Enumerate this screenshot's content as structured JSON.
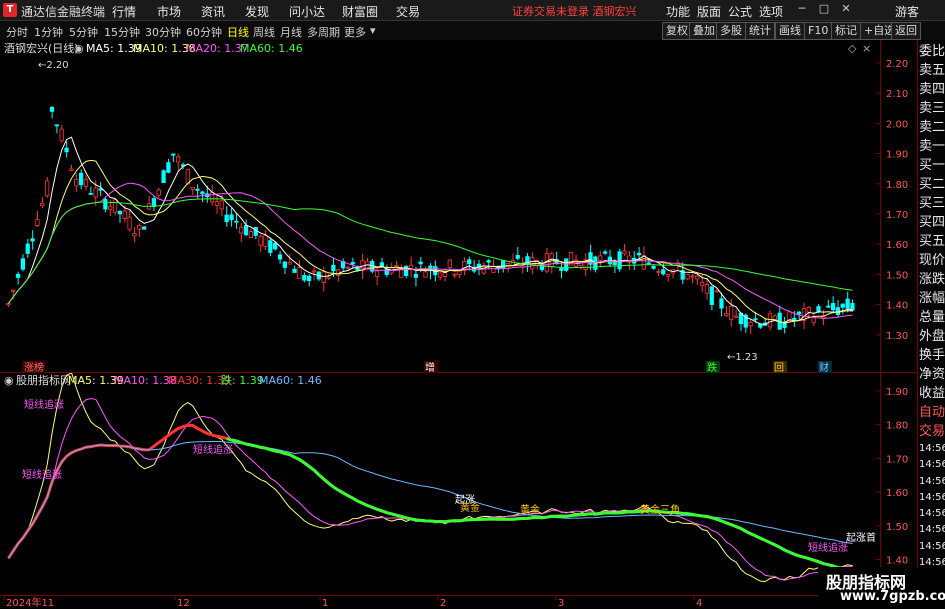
{
  "app": {
    "title": "通达信金融终端",
    "logo": "T"
  },
  "menu": [
    "行情",
    "市场",
    "资讯",
    "发现",
    "问小达",
    "财富圈",
    "交易"
  ],
  "notice": "证券交易未登录  酒钢宏兴",
  "right_menu": [
    "功能",
    "版面",
    "公式",
    "选项"
  ],
  "user": "游客",
  "toolbar": {
    "periods": [
      "分时",
      "1分钟",
      "5分钟",
      "15分钟",
      "30分钟",
      "60分钟",
      "日线",
      "周线",
      "月线",
      "多周期",
      "更多"
    ],
    "active_period": "日线",
    "right_buttons": [
      "复权",
      "叠加",
      "多股",
      "统计",
      "画线",
      "F10",
      "标记",
      "+自选",
      "返回"
    ]
  },
  "main_chart": {
    "title": "酒钢宏兴(日线)",
    "ma_legend": [
      {
        "label": "MA5: 1.39",
        "color": "#ffffff"
      },
      {
        "label": "MA10: 1.38",
        "color": "#ffff66"
      },
      {
        "label": "MA20: 1.37",
        "color": "#ff55ff"
      },
      {
        "label": "MA60: 1.46",
        "color": "#33ff33"
      }
    ],
    "y_ticks": [
      "2.20",
      "2.10",
      "2.00",
      "1.90",
      "1.80",
      "1.70",
      "1.60",
      "1.50",
      "1.40",
      "1.30"
    ],
    "high_label": "2.20",
    "low_label": "1.23",
    "markers": [
      "涨榜",
      "增",
      "跌",
      "回",
      "财"
    ]
  },
  "sub_chart": {
    "title": "股朋指标网",
    "legend": [
      {
        "label": "MA5: 1.39",
        "color": "#ffff66"
      },
      {
        "label": "MA10: 1.38",
        "color": "#ff55ff"
      },
      {
        "label": "MA30: 1.39",
        "color": "#ff3333"
      },
      {
        "label": "跌: 1.39",
        "color": "#33ff33"
      },
      {
        "label": "MA60: 1.46",
        "color": "#66bbff"
      }
    ],
    "y_ticks": [
      "1.90",
      "1.80",
      "1.70",
      "1.60",
      "1.50",
      "1.40",
      "1.30"
    ],
    "signals": [
      "短线追涨",
      "短线追涨",
      "短线追涨",
      "起涨",
      "黄金",
      "黄金",
      "黄金三角",
      "短线追涨",
      "起涨首"
    ]
  },
  "x_axis": [
    "2024年11",
    "12",
    "1",
    "2",
    "3",
    "4"
  ],
  "right_panel": [
    "委比",
    "卖五",
    "卖四",
    "卖三",
    "卖二",
    "卖一",
    "买一",
    "买二",
    "买三",
    "买四",
    "买五",
    "现价",
    "涨跌",
    "涨幅",
    "总量",
    "外盘",
    "换手",
    "净资",
    "收益",
    "自动",
    "交易",
    "14:56",
    "14:56",
    "14:56",
    "14:56",
    "14:56",
    "14:56",
    "14:56",
    "14:56",
    "14:56"
  ],
  "watermark": {
    "line1": "股朋指标网",
    "line2": "www.7gpzb.com"
  },
  "colors": {
    "up": "#ff3333",
    "down": "#00ffff",
    "accent": "#e0262b"
  }
}
